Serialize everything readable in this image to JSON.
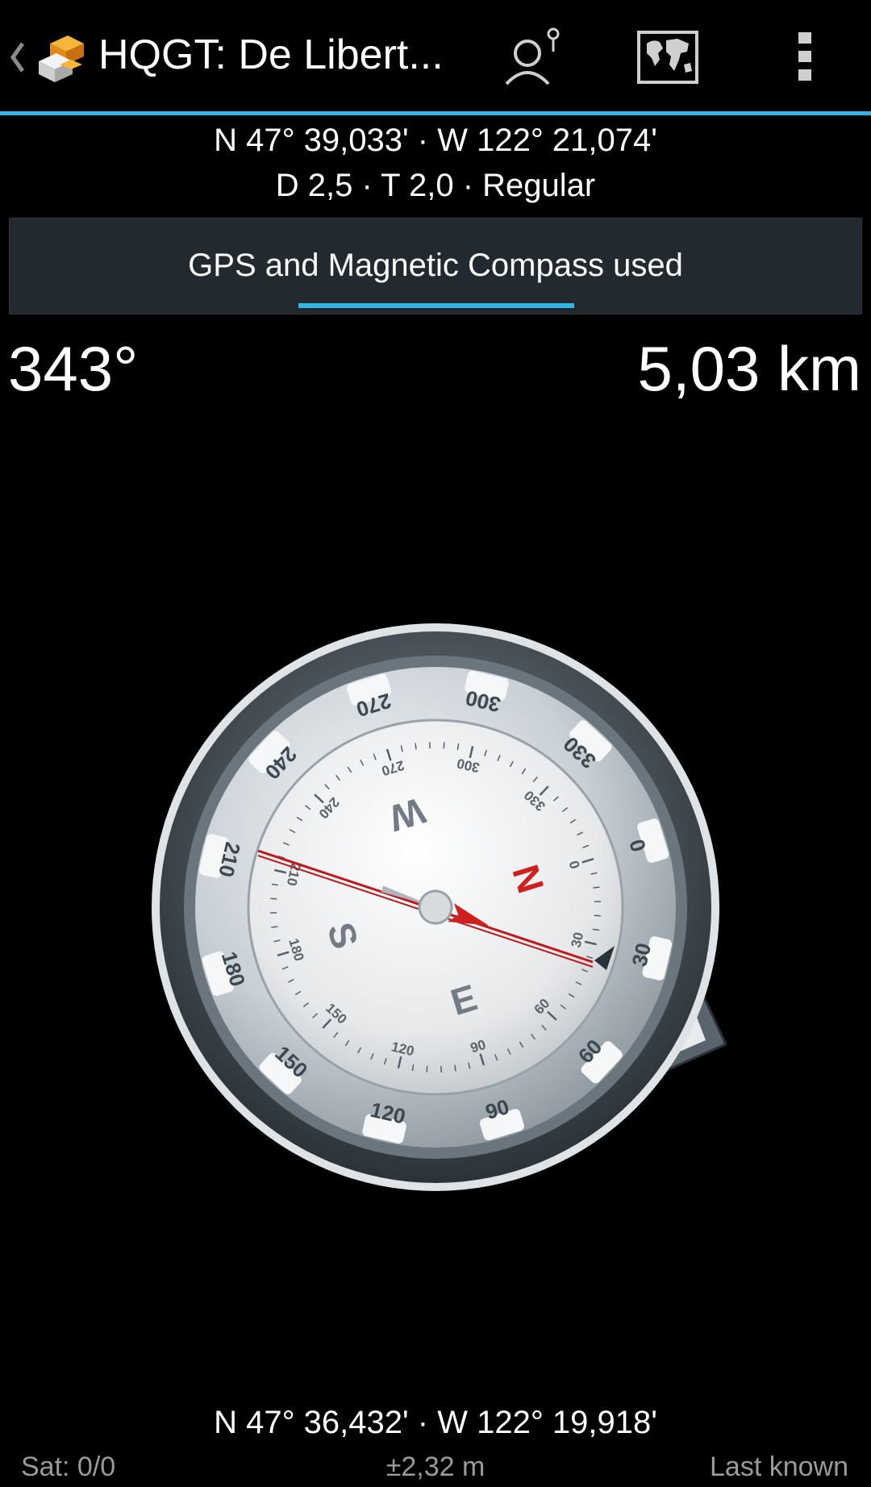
{
  "actionbar": {
    "title": "HQGT: De Libert...",
    "back_icon": "chevron-left-icon",
    "app_icon": "geocache-app-icon",
    "actions": [
      {
        "name": "person-location-icon"
      },
      {
        "name": "world-map-icon"
      },
      {
        "name": "overflow-menu-icon"
      }
    ],
    "accent": "#33b5e5"
  },
  "target": {
    "coords": "N 47° 39,033' · W 122° 21,074'",
    "info": "D 2,5 · T 2,0 · Regular"
  },
  "mode": {
    "label": "GPS and Magnetic Compass used"
  },
  "bearing": "343°",
  "distance": "5,03 km",
  "compass": {
    "bezel_numbers": [
      "0",
      "30",
      "60",
      "90",
      "120",
      "150",
      "180",
      "210",
      "240",
      "270",
      "300",
      "330"
    ],
    "inner_numbers": [
      "0",
      "30",
      "60",
      "90",
      "120",
      "150",
      "180",
      "210",
      "240",
      "270",
      "300",
      "330"
    ],
    "cardinals": [
      "N",
      "E",
      "S",
      "W"
    ],
    "needle_color": "#d0201e"
  },
  "current": {
    "coords": "N 47° 36,432' · W 122° 19,918'"
  },
  "status": {
    "satellites": "Sat: 0/0",
    "accuracy": "±2,32 m",
    "fix": "Last known"
  }
}
